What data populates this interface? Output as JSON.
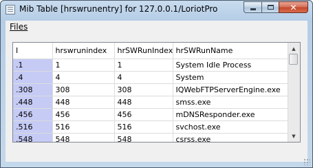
{
  "window": {
    "title": "Mib Table [hrswrunentry] for 127.0.0.1/LoriotPro"
  },
  "menu": {
    "files_label": "Files"
  },
  "table": {
    "columns": [
      "I",
      "hrswrunindex",
      "hrSWRunIndex",
      "hrSWRunName"
    ],
    "rows": [
      [
        ".1",
        "1",
        "1",
        "System Idle Process"
      ],
      [
        ".4",
        "4",
        "4",
        "System"
      ],
      [
        ".308",
        "308",
        "308",
        "IQWebFTPServerEngine.exe"
      ],
      [
        ".448",
        "448",
        "448",
        "smss.exe"
      ],
      [
        ".456",
        "456",
        "456",
        "mDNSResponder.exe"
      ],
      [
        ".516",
        "516",
        "516",
        "svchost.exe"
      ],
      [
        ".548",
        "548",
        "548",
        "csrss.exe"
      ]
    ]
  },
  "colors": {
    "index_column_highlight": "#c5cbf5",
    "close_button": "#c4462a"
  },
  "icons": {
    "app": "table-window-icon",
    "minimize": "minimize-icon",
    "maximize": "maximize-icon",
    "close": "close-icon"
  }
}
